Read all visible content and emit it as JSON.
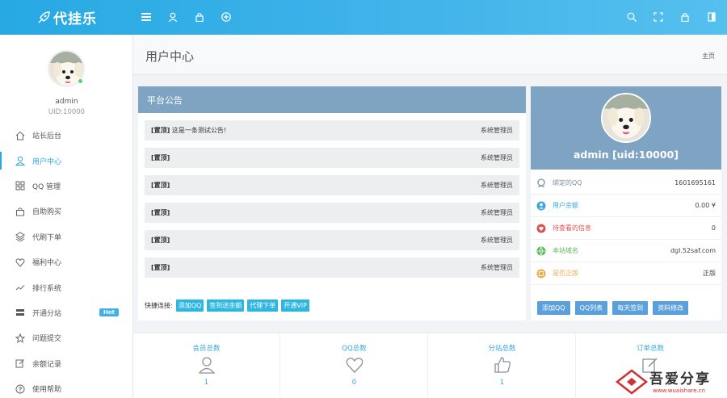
{
  "brand": {
    "title": "代挂乐"
  },
  "topbar": {
    "icons": [
      "menu-icon",
      "user-icon",
      "lock-icon",
      "plus-circle-icon",
      "search-icon",
      "fullscreen-icon",
      "lock-icon",
      "sidebar-toggle-icon"
    ]
  },
  "sidebar": {
    "user_name": "admin",
    "user_uid": "UID:10000",
    "items": [
      {
        "label": "站长后台",
        "icon": "home-icon"
      },
      {
        "label": "用户中心",
        "icon": "user-icon"
      },
      {
        "label": "QQ 管理",
        "icon": "grid-icon"
      },
      {
        "label": "自助购买",
        "icon": "bag-icon"
      },
      {
        "label": "代刷下单",
        "icon": "layers-icon"
      },
      {
        "label": "福利中心",
        "icon": "heart-icon"
      },
      {
        "label": "排行系统",
        "icon": "trend-icon"
      },
      {
        "label": "开通分站",
        "icon": "server-icon",
        "badge": "Hot"
      },
      {
        "label": "问题提交",
        "icon": "star-icon"
      },
      {
        "label": "余额记录",
        "icon": "edit-icon"
      },
      {
        "label": "使用帮助",
        "icon": "help-icon"
      }
    ]
  },
  "page": {
    "title": "用户中心",
    "breadcrumb": "主页"
  },
  "notice": {
    "title": "平台公告",
    "rows": [
      {
        "tag": "[置顶]",
        "text": "这是一条测试公告!",
        "author": "系统管理员"
      },
      {
        "tag": "[置顶]",
        "text": "",
        "author": "系统管理员"
      },
      {
        "tag": "[置顶]",
        "text": "",
        "author": "系统管理员"
      },
      {
        "tag": "[置顶]",
        "text": "",
        "author": "系统管理员"
      },
      {
        "tag": "[置顶]",
        "text": "",
        "author": "系统管理员"
      },
      {
        "tag": "[置顶]",
        "text": "",
        "author": "系统管理员"
      }
    ],
    "quick_label": "快捷连接:",
    "quick_links": [
      "添加QQ",
      "签到送余额",
      "代理下单",
      "开通VIP"
    ]
  },
  "profile": {
    "name": "admin [uid:10000]",
    "rows": [
      {
        "label": "绑定的QQ",
        "value": "1601695161",
        "color": "#7a8fa6",
        "icon": "qq-icon"
      },
      {
        "label": "用户余额",
        "value": "0.00 ¥",
        "color": "#39a8da",
        "icon": "wallet-icon"
      },
      {
        "label": "待查看的信息",
        "value": "0",
        "color": "#d9534f",
        "icon": "message-icon"
      },
      {
        "label": "本站域名",
        "value": "dgl.52saf.com",
        "color": "#5cb85c",
        "icon": "globe-icon"
      },
      {
        "label": "是否正版",
        "value": "正版",
        "color": "#f0ad4e",
        "icon": "shield-icon"
      }
    ],
    "buttons": [
      "添加QQ",
      "QQ列表",
      "每天签到",
      "资料修改"
    ]
  },
  "stats": [
    {
      "title": "会员总数",
      "value": "1",
      "icon": "user-icon"
    },
    {
      "title": "QQ总数",
      "value": "0",
      "icon": "heart-icon"
    },
    {
      "title": "分站总数",
      "value": "1",
      "icon": "thumbs-up-icon"
    },
    {
      "title": "订单总数",
      "value": "",
      "icon": "edit-icon"
    }
  ],
  "watermark": {
    "text": "吾爱分享",
    "sub": "www.wuaishare.cn"
  },
  "colors": {
    "accent": "#27a9e3",
    "panel_header": "#7ea3c3",
    "link_button": "#2db7e0",
    "profile_button": "#5aa0dc"
  }
}
